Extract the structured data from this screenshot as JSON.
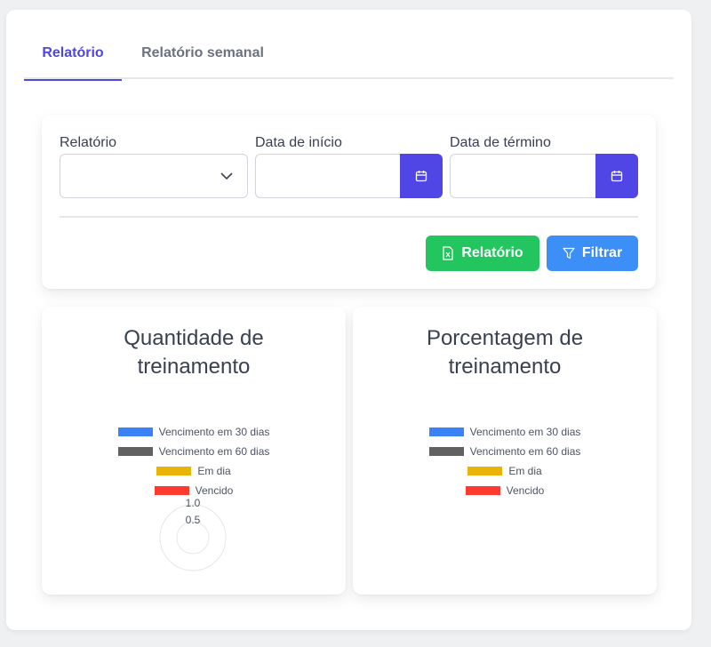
{
  "tabs": [
    {
      "label": "Relatório",
      "active": true
    },
    {
      "label": "Relatório semanal",
      "active": false
    }
  ],
  "filters": {
    "report_label": "Relatório",
    "report_value": "",
    "start_label": "Data de início",
    "start_value": "",
    "end_label": "Data de término",
    "end_value": ""
  },
  "buttons": {
    "report": "Relatório",
    "filter": "Filtrar"
  },
  "colors": {
    "primary": "#4f46e5",
    "success": "#22c55e",
    "info": "#3b8ff6"
  },
  "charts": [
    {
      "title": "Quantidade de treinamento",
      "legend": [
        {
          "label": "Vencimento em 30 dias",
          "color": "#3b82f6"
        },
        {
          "label": "Vencimento em 60 dias",
          "color": "#616161"
        },
        {
          "label": "Em dia",
          "color": "#eab308"
        },
        {
          "label": "Vencido",
          "color": "#ff3b30"
        }
      ],
      "ticks": [
        "1.0",
        "0.5"
      ]
    },
    {
      "title": "Porcentagem de treinamento",
      "legend": [
        {
          "label": "Vencimento em 30 dias",
          "color": "#3b82f6"
        },
        {
          "label": "Vencimento em 60 dias",
          "color": "#616161"
        },
        {
          "label": "Em dia",
          "color": "#eab308"
        },
        {
          "label": "Vencido",
          "color": "#ff3b30"
        }
      ]
    }
  ],
  "chart_data": [
    {
      "type": "polar-area",
      "title": "Quantidade de treinamento",
      "categories": [
        "Vencimento em 30 dias",
        "Vencimento em 60 dias",
        "Em dia",
        "Vencido"
      ],
      "values": [],
      "ticks": [
        "1.0",
        "0.5"
      ],
      "rlim": [
        0,
        1
      ]
    },
    {
      "type": "pie",
      "title": "Porcentagem de treinamento",
      "categories": [
        "Vencimento em 30 dias",
        "Vencimento em 60 dias",
        "Em dia",
        "Vencido"
      ],
      "values": []
    }
  ]
}
